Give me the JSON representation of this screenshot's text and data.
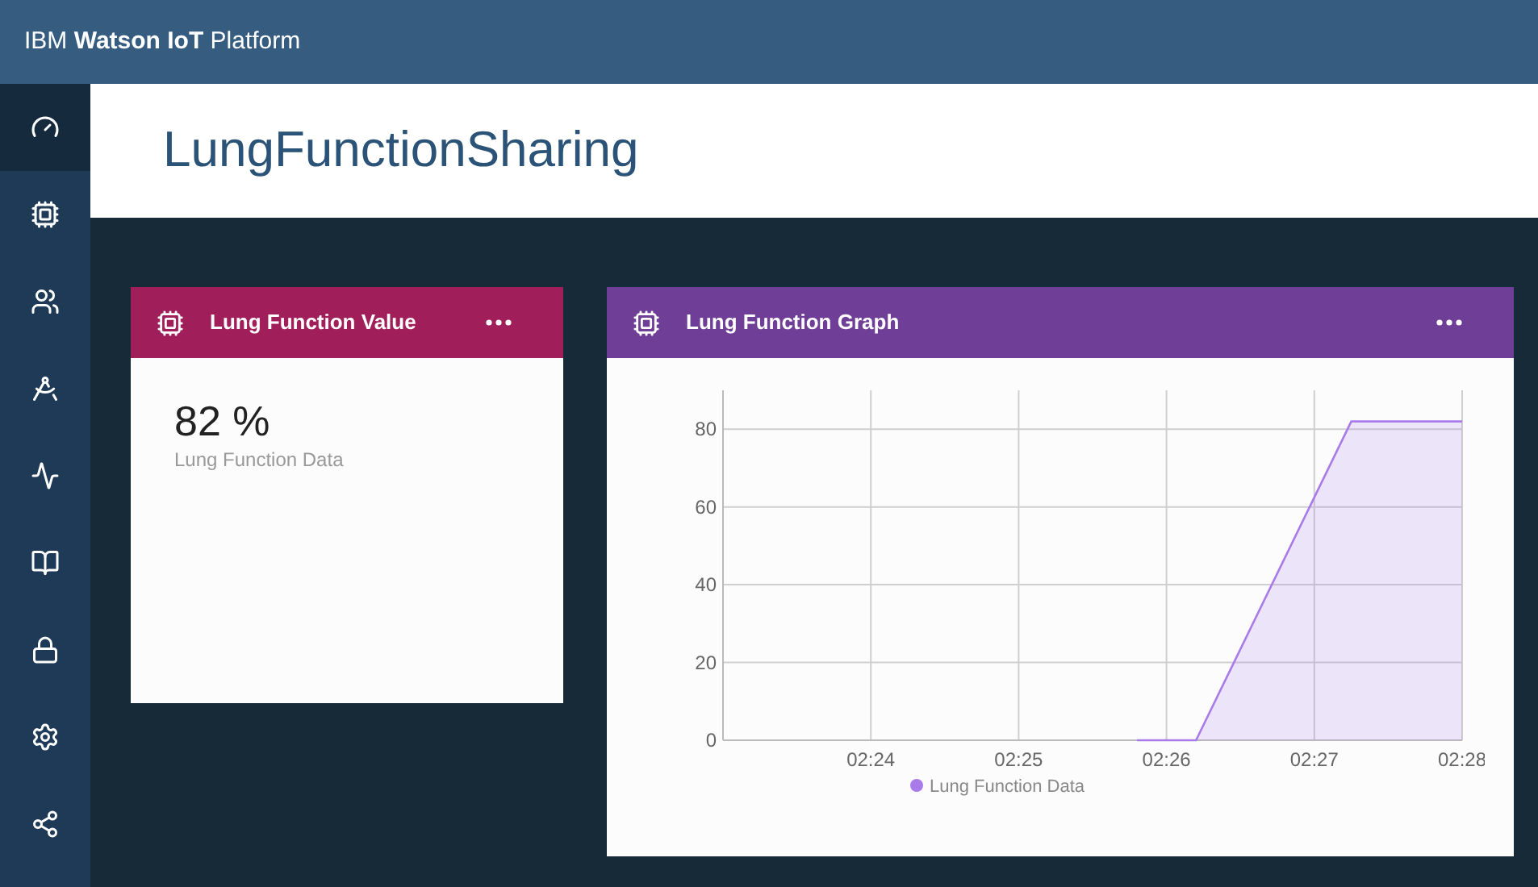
{
  "app_bar": {
    "title": "IBM **Watson IoT** Platform"
  },
  "sidebar": {
    "items": [
      {
        "selected": true
      },
      {
        "selected": false
      },
      {
        "selected": false
      },
      {
        "selected": false
      },
      {
        "selected": false
      },
      {
        "selected": false
      },
      {
        "selected": false
      },
      {
        "selected": false
      },
      {
        "selected": false
      }
    ]
  },
  "page": {
    "title": "LungFunctionSharing"
  },
  "cards": [
    {
      "kind": "value",
      "title": "Lung Function Value",
      "color": "#a01e5a",
      "value": "82 %",
      "caption": "Lung Function Data"
    },
    {
      "kind": "chart",
      "title": "Lung Function Graph",
      "color": "#6f3f98",
      "chart_data": {
        "type": "area",
        "x": [
          145.8,
          146.2,
          147.25,
          148
        ],
        "series": [
          {
            "name": "Lung Function Data",
            "color": "#a87be8",
            "values": [
              0,
              0,
              82,
              82
            ]
          }
        ],
        "grid": true,
        "xlim": [
          143,
          148
        ],
        "ylim": [
          0,
          90
        ],
        "xticks": [
          {
            "value": 144,
            "label": "02:24"
          },
          {
            "value": 145,
            "label": "02:25"
          },
          {
            "value": 146,
            "label": "02:26"
          },
          {
            "value": 147,
            "label": "02:27"
          },
          {
            "value": 148,
            "label": "02:28"
          }
        ],
        "yticks": [
          0,
          20,
          40,
          60,
          80
        ]
      }
    }
  ]
}
